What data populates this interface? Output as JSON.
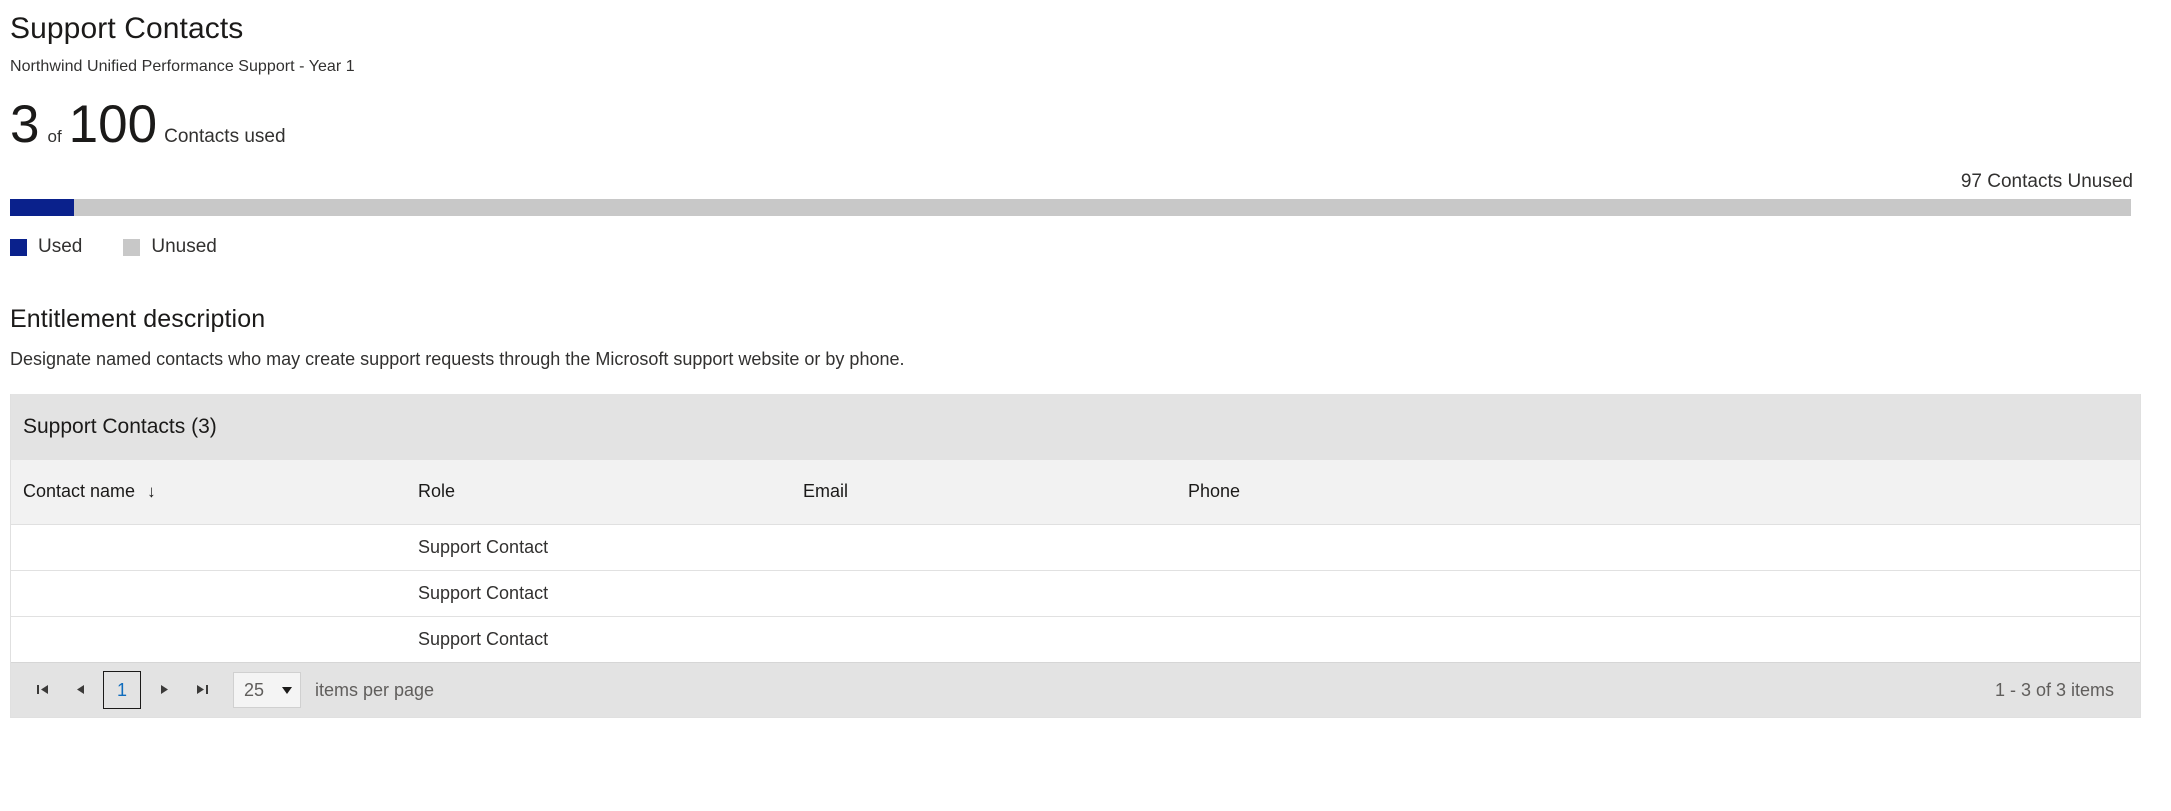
{
  "header": {
    "title": "Support Contacts",
    "subtitle": "Northwind Unified Performance Support - Year 1"
  },
  "usage": {
    "used": "3",
    "of_label": "of",
    "total": "100",
    "caption": "Contacts used",
    "unused_label": "97 Contacts Unused",
    "used_percent": 3,
    "unused_percent": 97,
    "used_color": "#0a218c",
    "unused_color": "#c8c8c8"
  },
  "legend": {
    "items": [
      {
        "label": "Used",
        "color": "#0a218c"
      },
      {
        "label": "Unused",
        "color": "#c8c8c8"
      }
    ]
  },
  "entitlement": {
    "heading": "Entitlement description",
    "body": "Designate named contacts who may create support requests through the Microsoft support website or by phone."
  },
  "grid": {
    "title": "Support Contacts (3)",
    "columns": [
      {
        "label": "Contact name",
        "sort_icon": "↓"
      },
      {
        "label": "Role"
      },
      {
        "label": "Email"
      },
      {
        "label": "Phone"
      }
    ],
    "rows": [
      {
        "contact_name": "",
        "role": "Support Contact",
        "email": "",
        "phone": ""
      },
      {
        "contact_name": "",
        "role": "Support Contact",
        "email": "",
        "phone": ""
      },
      {
        "contact_name": "",
        "role": "Support Contact",
        "email": "",
        "phone": ""
      }
    ]
  },
  "pager": {
    "first_glyph": "⏮",
    "prev_glyph": "◀",
    "current_page": "1",
    "next_glyph": "▶",
    "last_glyph": "⏭",
    "items_per_page_value": "25",
    "items_per_page_label": "items per page",
    "range_text": "1 - 3 of 3 items"
  },
  "chart_data": {
    "type": "bar",
    "title": "Contacts used",
    "categories": [
      "Used",
      "Unused"
    ],
    "values": [
      3,
      97
    ],
    "total": 100,
    "unit": "Contacts",
    "orientation": "horizontal-stacked",
    "colors": [
      "#0a218c",
      "#c8c8c8"
    ],
    "annotations": [
      "3 of 100 Contacts used",
      "97 Contacts Unused"
    ],
    "legend_position": "bottom-left",
    "grid": false
  }
}
